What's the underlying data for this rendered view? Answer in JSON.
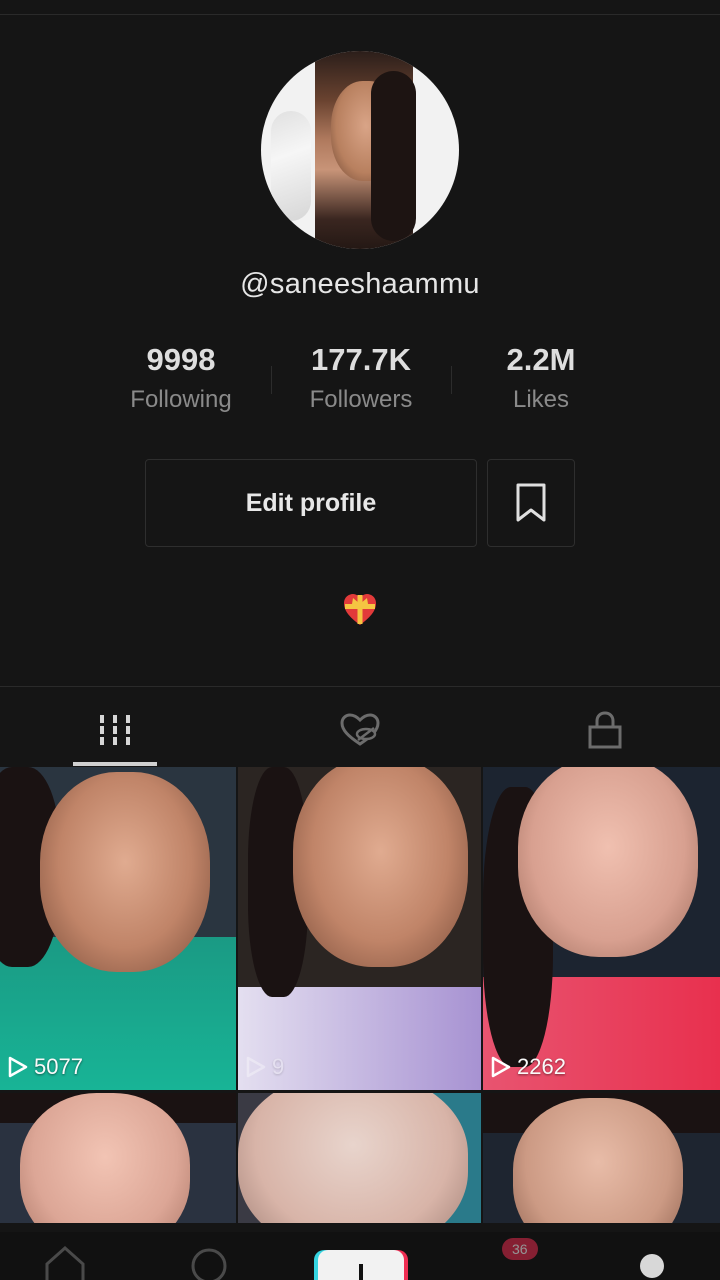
{
  "profile": {
    "username": "@saneeshaammu",
    "stats": [
      {
        "value": "9998",
        "label": "Following"
      },
      {
        "value": "177.7K",
        "label": "Followers"
      },
      {
        "value": "2.2M",
        "label": "Likes"
      }
    ],
    "edit_button": "Edit profile",
    "bio_emoji": "heart-gift-emoji"
  },
  "tabs": [
    {
      "name": "videos",
      "icon": "grid-bars-icon",
      "active": true
    },
    {
      "name": "liked",
      "icon": "heart-hidden-icon",
      "active": false
    },
    {
      "name": "private",
      "icon": "lock-icon",
      "active": false
    }
  ],
  "videos": [
    {
      "views": "5077",
      "accent": "#1fa890"
    },
    {
      "views": "9",
      "accent": "#b49ad8"
    },
    {
      "views": "2262",
      "accent": "#e3405e"
    },
    {
      "views": "",
      "accent": "#5a6a80"
    },
    {
      "views": "",
      "accent": "#6fa8b8"
    },
    {
      "views": "",
      "accent": "#2a3a48"
    }
  ],
  "bottom_nav": {
    "items": [
      "home-icon",
      "search-icon",
      "create-plus-icon",
      "inbox-icon",
      "profile-icon"
    ],
    "badge": "36"
  },
  "colors": {
    "background": "#151515",
    "border": "#2e2e2e",
    "muted_text": "#8a8a8a"
  }
}
